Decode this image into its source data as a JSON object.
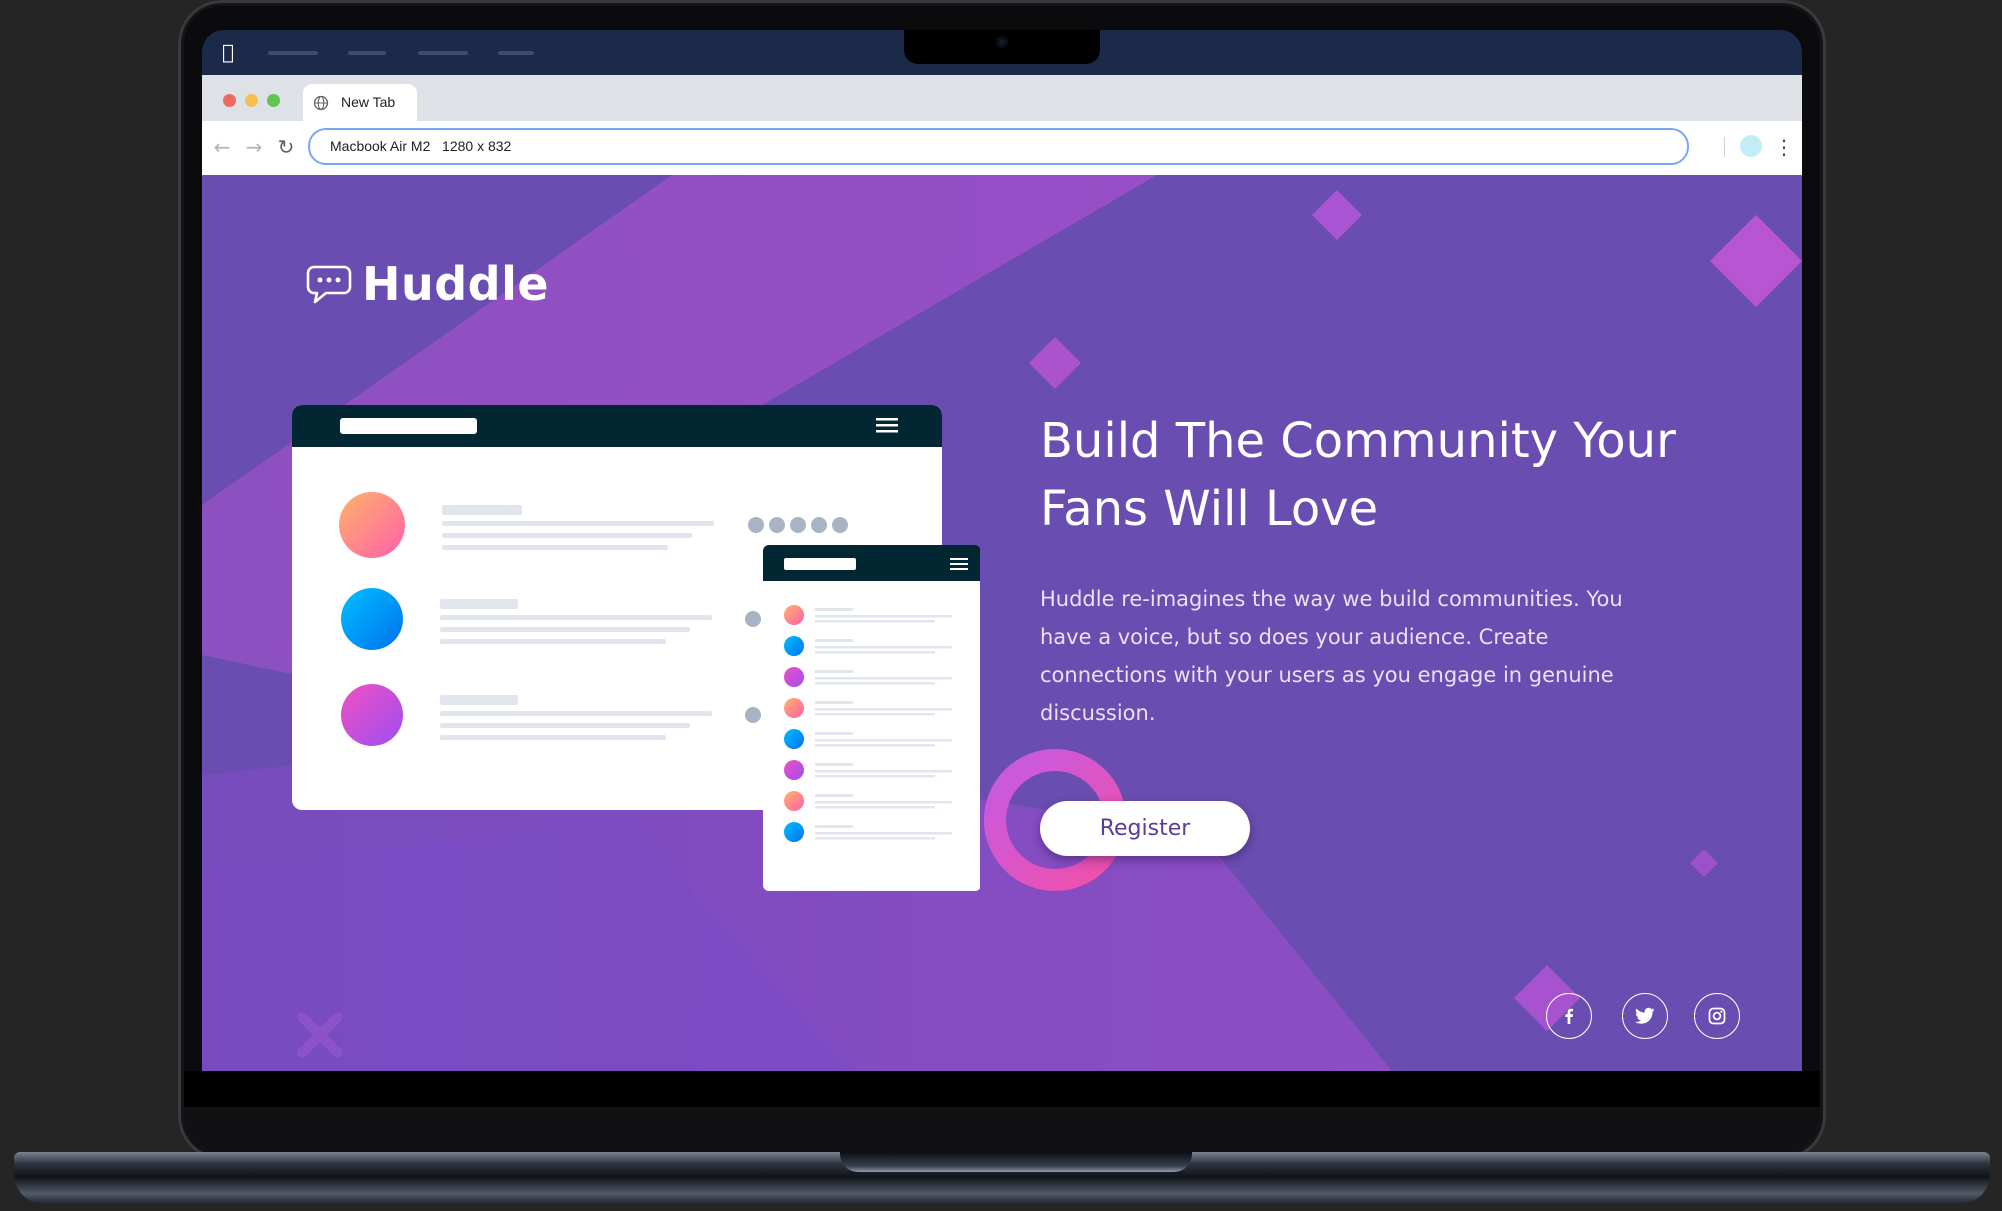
{
  "browser": {
    "tab": {
      "label": "New Tab",
      "icon": "globe-icon"
    },
    "address_bar": {
      "value": "Macbook Air M2   1280 x 832"
    },
    "nav": {
      "back_icon": "arrow-left-icon",
      "forward_icon": "arrow-right-icon",
      "reload_icon": "reload-icon",
      "menu_icon": "kebab-menu-icon"
    }
  },
  "page": {
    "brand": {
      "name": "Huddle",
      "icon": "chat-bubble-icon"
    },
    "hero": {
      "title": "Build The Community Your Fans Will Love",
      "description": "Huddle re-imagines the way we build communities. You have a voice, but so does your audience. Create connections with your users as you engage in genuine discussion.",
      "cta_label": "Register"
    },
    "social": [
      {
        "name": "facebook",
        "icon": "facebook-icon"
      },
      {
        "name": "twitter",
        "icon": "twitter-icon"
      },
      {
        "name": "instagram",
        "icon": "instagram-icon"
      }
    ],
    "colors": {
      "background": "#6a4db1",
      "accent": "#c158de",
      "button_text": "#5a3c9c",
      "mockup_header": "#022732"
    }
  }
}
